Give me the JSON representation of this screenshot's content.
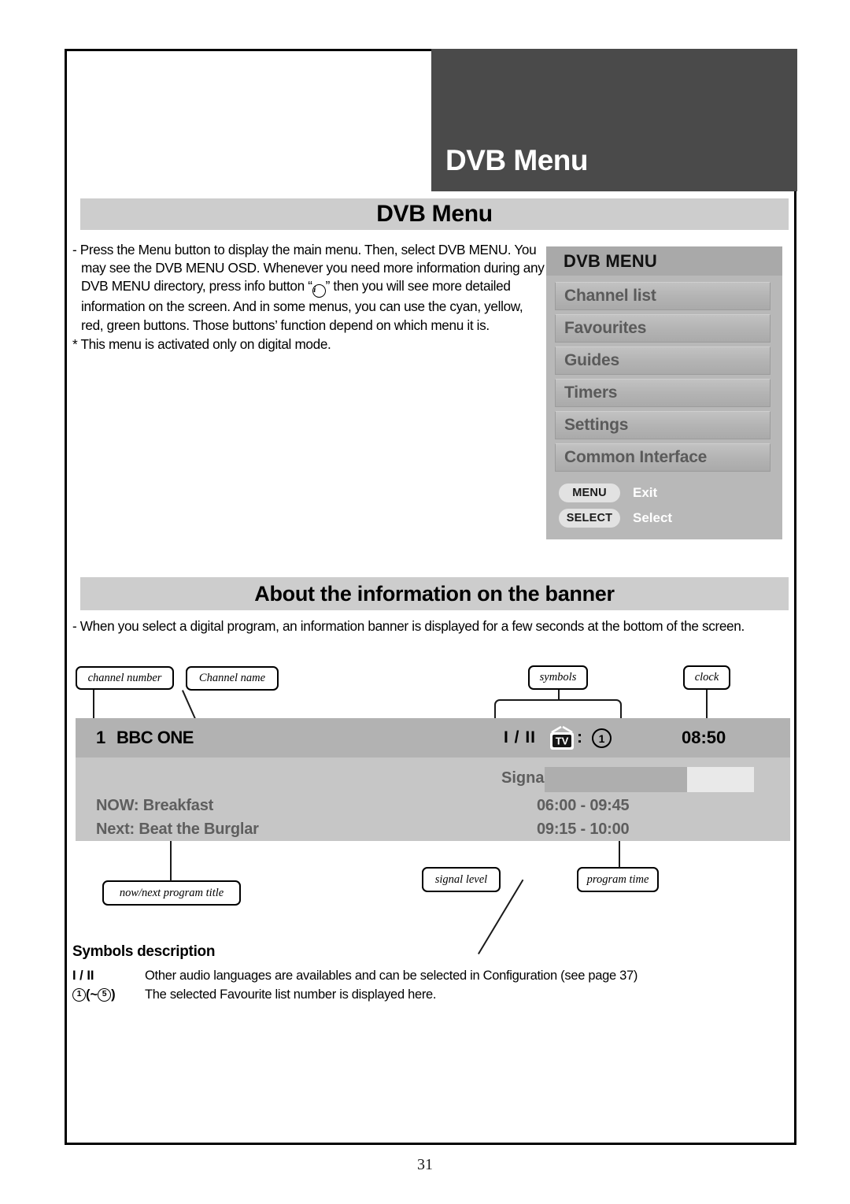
{
  "masthead": {
    "title": "DVB Menu"
  },
  "sections": {
    "dvb_menu_heading": "DVB Menu",
    "banner_heading": "About the information on the banner"
  },
  "intro": {
    "bullet": "- Press the Menu button to display the main menu. Then, select DVB MENU. You may see the DVB MENU OSD. Whenever you need more information during any DVB MENU directory, press info button “",
    "info_icon_glyph": "i",
    "bullet_cont": "” then you will see more detailed information on the screen. And in some menus, you can use the cyan, yellow, red, green buttons. Those buttons’ function depend on which menu it is.",
    "note": "* This menu is activated only on digital mode."
  },
  "osd": {
    "title": "DVB MENU",
    "items": [
      {
        "label": "Channel list"
      },
      {
        "label": "Favourites"
      },
      {
        "label": "Guides"
      },
      {
        "label": "Timers"
      },
      {
        "label": "Settings"
      },
      {
        "label": "Common Interface"
      }
    ],
    "keys": [
      {
        "key": "MENU",
        "action": "Exit"
      },
      {
        "key": "SELECT",
        "action": "Select"
      }
    ]
  },
  "banner_intro": "- When you select a digital program, an information banner is displayed for a few seconds at the bottom of the screen.",
  "callouts": {
    "channel_number": "channel number",
    "channel_name": "Channel name",
    "symbols": "symbols",
    "clock": "clock",
    "now_next_program_title": "now/next program title",
    "signal_level": "signal level",
    "program_time": "program time"
  },
  "tv_banner": {
    "channel_number": "1",
    "channel_name": "BBC ONE",
    "audio_symbol": "I / II",
    "tv_icon_text": "TV",
    "symbol_colon": ":",
    "favourite_number": "1",
    "clock": "08:50",
    "signal_label": "Signal:",
    "signal_percent": 68,
    "now_label": "NOW: Breakfast",
    "now_time": "06:00 - 09:45",
    "next_label": "Next: Beat the Burglar",
    "next_time": "09:15 - 10:00"
  },
  "symbols_description": {
    "title": "Symbols description",
    "rows": [
      {
        "key_text": "I / II",
        "key_type": "text",
        "description": "Other audio languages are availables and can be selected in Configuration (see page 37)"
      },
      {
        "key_text": "① (~⑤)",
        "key_type": "circled",
        "key_first": "1",
        "key_mid": " (~",
        "key_second": "5",
        "key_last": ")",
        "description": "The selected Favourite list number is displayed here."
      }
    ]
  },
  "page_number": "31",
  "colors": {
    "masthead_bg": "#4a4a4a",
    "section_bar_bg": "#cdcdcd",
    "osd_panel_bg": "#b8b8b8",
    "osd_title_bg": "#a9a9a9",
    "banner_top_bg": "#b2b2b2",
    "banner_bottom_bg": "#c6c6c6",
    "signal_fill": "#aeaeae",
    "signal_track": "#e9e9e9"
  }
}
